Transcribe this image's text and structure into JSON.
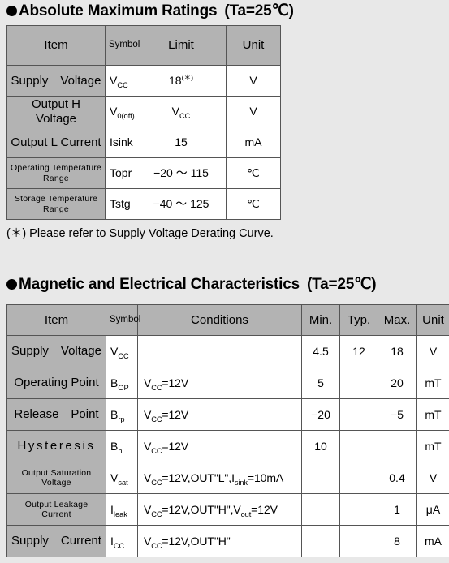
{
  "sections": {
    "absolute_maximum": {
      "bullet": "filled-circle",
      "title": "Absolute Maximum Ratings",
      "condition": "(Ta=25℃)",
      "footnote": "(＊) Please refer to Supply Voltage Derating Curve.",
      "table": {
        "headers": [
          "Item",
          "Symbol",
          "Limit",
          "Unit"
        ],
        "rows": [
          {
            "item": "Supply　Voltage",
            "item_style": "normal",
            "symbol_base": "V",
            "symbol_sub": "CC",
            "limit": "18",
            "limit_sup": "(＊)",
            "unit": "V"
          },
          {
            "item": "Output H Voltage",
            "item_style": "normal",
            "symbol_base": "V",
            "symbol_sub": "0(off)",
            "limit_base": "V",
            "limit_sub": "CC",
            "unit": "V"
          },
          {
            "item": "Output L Current",
            "item_style": "normal",
            "symbol_base": "I",
            "symbol_sub": "",
            "symbol_plain": "Isink",
            "limit": "15",
            "unit": "mA"
          },
          {
            "item": "Operating Temperature Range",
            "item_style": "small",
            "symbol_plain": "Topr",
            "limit": "−20 ～ 115",
            "unit": "℃"
          },
          {
            "item": "Storage Temperature Range",
            "item_style": "small",
            "symbol_plain": "Tstg",
            "limit": "−40 ～ 125",
            "unit": "℃"
          }
        ]
      }
    },
    "magnetic_electrical": {
      "bullet": "filled-circle",
      "title": "Magnetic and Electrical Characteristics",
      "condition": "(Ta=25℃)",
      "table": {
        "headers": [
          "Item",
          "Symbol",
          "Conditions",
          "Min.",
          "Typ.",
          "Max.",
          "Unit"
        ],
        "rows": [
          {
            "item": "Supply　Voltage",
            "item_style": "normal",
            "symbol_base": "V",
            "symbol_sub": "CC",
            "conditions": "",
            "min": "4.5",
            "typ": "12",
            "max": "18",
            "unit": "V"
          },
          {
            "item": "Operating Point",
            "item_style": "normal",
            "symbol_base": "B",
            "symbol_sub": "OP",
            "cond_base": "V",
            "cond_sub": "CC",
            "cond_tail": "=12V",
            "min": "5",
            "typ": "",
            "max": "20",
            "unit": "mT"
          },
          {
            "item": "Release　Point",
            "item_style": "normal",
            "symbol_base": "B",
            "symbol_sub": "rp",
            "cond_base": "V",
            "cond_sub": "CC",
            "cond_tail": "=12V",
            "min": "−20",
            "typ": "",
            "max": "−5",
            "unit": "mT"
          },
          {
            "item": "Hysteresis",
            "item_style": "spaced",
            "symbol_base": "B",
            "symbol_sub": "h",
            "cond_base": "V",
            "cond_sub": "CC",
            "cond_tail": "=12V",
            "min": "10",
            "typ": "",
            "max": "",
            "unit": "mT"
          },
          {
            "item": "Output Saturation Voltage",
            "item_style": "small",
            "symbol_base": "V",
            "symbol_sub": "sat",
            "cond_base": "V",
            "cond_sub": "CC",
            "cond_tail": "=12V,OUT\"L\",",
            "cond_base2": "I",
            "cond_sub2": "sink",
            "cond_tail2": "=10mA",
            "min": "",
            "typ": "",
            "max": "0.4",
            "unit": "V"
          },
          {
            "item": "Output Leakage Current",
            "item_style": "small",
            "symbol_base": "I",
            "symbol_sub": "leak",
            "cond_base": "V",
            "cond_sub": "CC",
            "cond_tail": "=12V,OUT\"H\",",
            "cond_base2": "V",
            "cond_sub2": "out",
            "cond_tail2": "=12V",
            "min": "",
            "typ": "",
            "max": "1",
            "unit": "μA"
          },
          {
            "item": "Supply　Current",
            "item_style": "normal",
            "symbol_base": "I",
            "symbol_sub": "CC",
            "cond_base": "V",
            "cond_sub": "CC",
            "cond_tail": "=12V,OUT\"H\"",
            "min": "",
            "typ": "",
            "max": "8",
            "unit": "mA"
          }
        ]
      }
    }
  },
  "colors": {
    "page_background": "#e8e8e8",
    "header_fill": "#b3b3b3",
    "cell_fill": "#ffffff",
    "border": "#555555",
    "text": "#000000"
  }
}
